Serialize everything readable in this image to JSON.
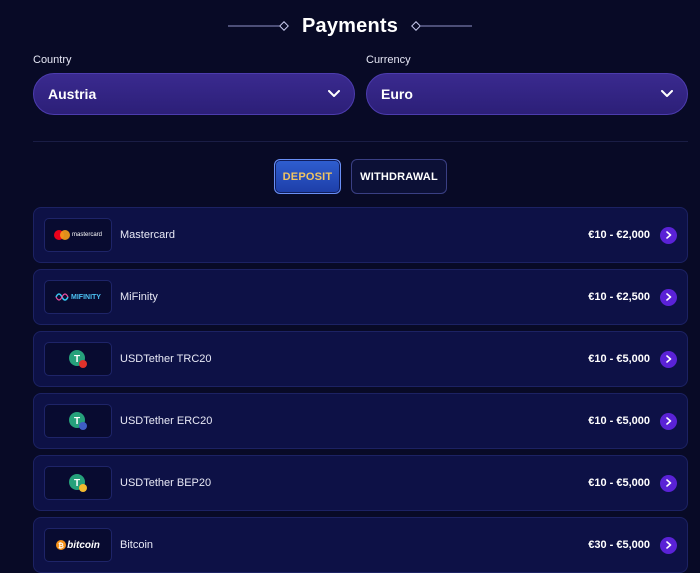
{
  "header": {
    "title": "Payments"
  },
  "filters": {
    "country_label": "Country",
    "country_value": "Austria",
    "currency_label": "Currency",
    "currency_value": "Euro"
  },
  "tabs": {
    "deposit_label": "DEPOSIT",
    "withdrawal_label": "WITHDRAWAL",
    "active": "DEPOSIT"
  },
  "payments": [
    {
      "name": "Mastercard",
      "range": "€10 - €2,000",
      "logo_text": "mastercard",
      "icon": "mastercard-logo"
    },
    {
      "name": "MiFinity",
      "range": "€10 - €2,500",
      "logo_text": "MIFINITY",
      "icon": "mifinity-logo"
    },
    {
      "name": "USDTether TRC20",
      "range": "€10 - €5,000",
      "logo_text": "T",
      "icon": "tether-trc20-icon"
    },
    {
      "name": "USDTether ERC20",
      "range": "€10 - €5,000",
      "logo_text": "T",
      "icon": "tether-erc20-icon"
    },
    {
      "name": "USDTether BEP20",
      "range": "€10 - €5,000",
      "logo_text": "T",
      "icon": "tether-bep20-icon"
    },
    {
      "name": "Bitcoin",
      "range": "€30 - €5,000",
      "logo_text": "bitcoin",
      "icon": "bitcoin-logo"
    }
  ],
  "colors": {
    "background": "#080a26",
    "select_fill": "#3a2a8f",
    "active_tab": "#2f5fd0",
    "active_tab_text": "#f0c462",
    "arrow_button": "#5a22d6",
    "row_fill": "#0d1146"
  }
}
